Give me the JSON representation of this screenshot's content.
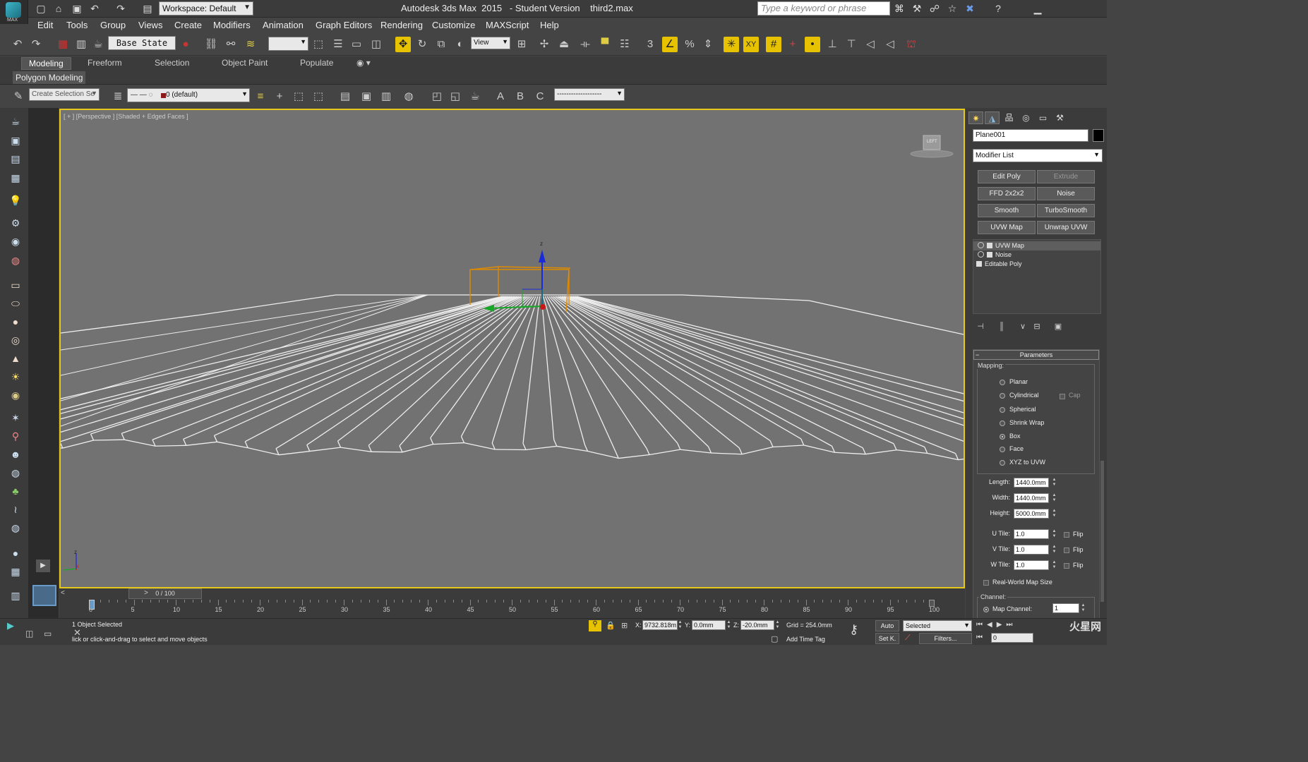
{
  "app": {
    "logo_label": "MAX",
    "title": "Autodesk 3ds Max  2015   - Student Version    third2.max",
    "workspace": "Workspace: Default",
    "search_placeholder": "Type a keyword or phrase"
  },
  "menu": [
    "Edit",
    "Tools",
    "Group",
    "Views",
    "Create",
    "Modifiers",
    "Animation",
    "Graph Editors",
    "Rendering",
    "Customize",
    "MAXScript",
    "Help"
  ],
  "toolbar": {
    "base_state": "Base State",
    "view_dropdown": "View"
  },
  "ribbon": {
    "tabs": [
      "Modeling",
      "Freeform",
      "Selection",
      "Object Paint",
      "Populate"
    ],
    "panel": "Polygon Modeling"
  },
  "toolbar2": {
    "selection_set_placeholder": "Create Selection Se",
    "layer": "0 (default)",
    "line_style": "-------------------"
  },
  "viewport": {
    "label": "[ + ] [Perspective ] [Shaded + Edged Faces ]",
    "viewcube": "LEFT",
    "axis_z": "z",
    "axis_x": "x"
  },
  "command_panel": {
    "object_name": "Plane001",
    "object_color": "#000000",
    "modifier_list": "Modifier List",
    "modifier_buttons": [
      "Edit Poly",
      "Extrude",
      "FFD 2x2x2",
      "Noise",
      "Smooth",
      "TurboSmooth",
      "UVW Map",
      "Unwrap UVW"
    ],
    "stack": [
      "UVW Map",
      "Noise",
      "Editable Poly"
    ],
    "parameters_title": "Parameters",
    "mapping_label": "Mapping:",
    "mapping_options": [
      "Planar",
      "Cylindrical",
      "Spherical",
      "Shrink Wrap",
      "Box",
      "Face",
      "XYZ to UVW"
    ],
    "mapping_selected": "Box",
    "cap_label": "Cap",
    "length_label": "Length:",
    "length": "1440.0mm",
    "width_label": "Width:",
    "width": "1440.0mm",
    "height_label": "Height:",
    "height": "5000.0mm",
    "utile_label": "U Tile:",
    "utile": "1.0",
    "vtile_label": "V Tile:",
    "vtile": "1.0",
    "wtile_label": "W Tile:",
    "wtile": "1.0",
    "flip_label": "Flip",
    "realworld_label": "Real-World Map Size",
    "channel_label": "Channel:",
    "map_channel_label": "Map Channel:",
    "map_channel": "1"
  },
  "timeline": {
    "slider": "0 / 100",
    "ticks": [
      "0",
      "5",
      "10",
      "15",
      "20",
      "25",
      "30",
      "35",
      "40",
      "45",
      "50",
      "55",
      "60",
      "65",
      "70",
      "75",
      "80",
      "85",
      "90",
      "95",
      "100"
    ]
  },
  "status": {
    "selected": "1 Object Selected",
    "prompt": "lick or click-and-drag to select and move objects",
    "x_label": "X:",
    "x": "9732.818m",
    "y_label": "Y:",
    "y": "0.0mm",
    "z_label": "Z:",
    "z": "-20.0mm",
    "grid": "Grid = 254.0mm",
    "add_time_tag": "Add Time Tag",
    "auto": "Auto",
    "setk": "Set K.",
    "selected_dd": "Selected",
    "filters": "Filters...",
    "frame": "0"
  },
  "watermark": "火星网"
}
